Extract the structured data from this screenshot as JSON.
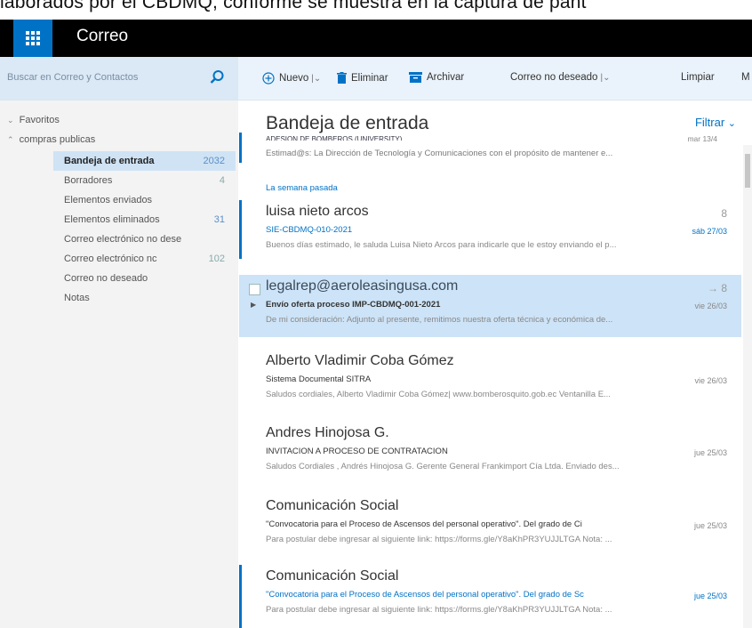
{
  "caption": "laborados por el CBDMQ, conforme se muestra en la captura de pant",
  "app": {
    "title": "Correo"
  },
  "search": {
    "placeholder": "Buscar en Correo y Contactos"
  },
  "toolbar": {
    "new_label": "Nuevo",
    "delete_label": "Eliminar",
    "archive_label": "Archivar",
    "junk_label": "Correo no deseado",
    "sweep_label": "Limpiar",
    "more_label": "M"
  },
  "sidebar": {
    "favorites": "Favoritos",
    "account": "compras publicas",
    "folders": [
      {
        "label": "Bandeja de entrada",
        "count": "2032"
      },
      {
        "label": "Borradores",
        "count": "4"
      },
      {
        "label": "Elementos enviados",
        "count": ""
      },
      {
        "label": "Elementos eliminados",
        "count": "31"
      },
      {
        "label": "Correo electrónico no dese",
        "count": ""
      },
      {
        "label": "Correo electrónico nc",
        "count": "102"
      },
      {
        "label": "Correo no deseado",
        "count": ""
      },
      {
        "label": "Notas",
        "count": ""
      }
    ]
  },
  "list": {
    "title": "Bandeja de entrada",
    "filter": "Filtrar",
    "partial": {
      "sender": "ADESION DE BOMBEROS (UNIVERSITY)",
      "date": "mar 13/4",
      "preview": "Estimad@s:   La Dirección de Tecnología y Comunicaciones con el propósito de mantener e..."
    },
    "group_label": "La semana pasada",
    "messages": [
      {
        "sender": "luisa nieto arcos",
        "subject": "SIE-CBDMQ-010-2021",
        "date": "sáb 27/03",
        "preview": "Buenos días estimado, le saluda Luisa Nieto Arcos para indicarle que le estoy enviando el p...",
        "flag": "8"
      },
      {
        "sender": "legalrep@aeroleasingusa.com",
        "subject": "Envío oferta proceso IMP-CBDMQ-001-2021",
        "date": "vie 26/03",
        "preview": "De mi consideración:  Adjunto al presente, remitimos nuestra oferta técnica y económica de...",
        "flag": "→ 8"
      },
      {
        "sender": "Alberto Vladimir Coba Gómez",
        "subject": "Sistema Documental SITRA",
        "date": "vie 26/03",
        "preview": "Saludos cordiales,  Alberto Vladimir Coba Gómez| www.bomberosquito.gob.ec Ventanilla E..."
      },
      {
        "sender": "Andres Hinojosa G.",
        "subject": "INVITACION A PROCESO DE CONTRATACION",
        "date": "jue 25/03",
        "preview": "Saludos Cordiales , Andrés Hinojosa G. Gerente General Frankimport Cía Ltda.  Enviado des..."
      },
      {
        "sender": "Comunicación Social",
        "subject": "\"Convocatoria para el Proceso de Ascensos del personal operativo\". Del grado de Ci",
        "date": "jue 25/03",
        "preview": "Para postular debe ingresar al siguiente link: https://forms.gle/Y8aKhPR3YUJJLTGA Nota: ..."
      },
      {
        "sender": "Comunicación Social",
        "subject": "\"Convocatoria para el Proceso de Ascensos del personal operativo\". Del grado de Sc",
        "date": "jue 25/03",
        "preview": "Para postular debe ingresar al siguiente link: https://forms.gle/Y8aKhPR3YUJJLTGA Nota: ..."
      }
    ]
  },
  "colors": {
    "accent": "#0072c6",
    "topbar": "#000000",
    "selected_row": "#cde3f7"
  }
}
